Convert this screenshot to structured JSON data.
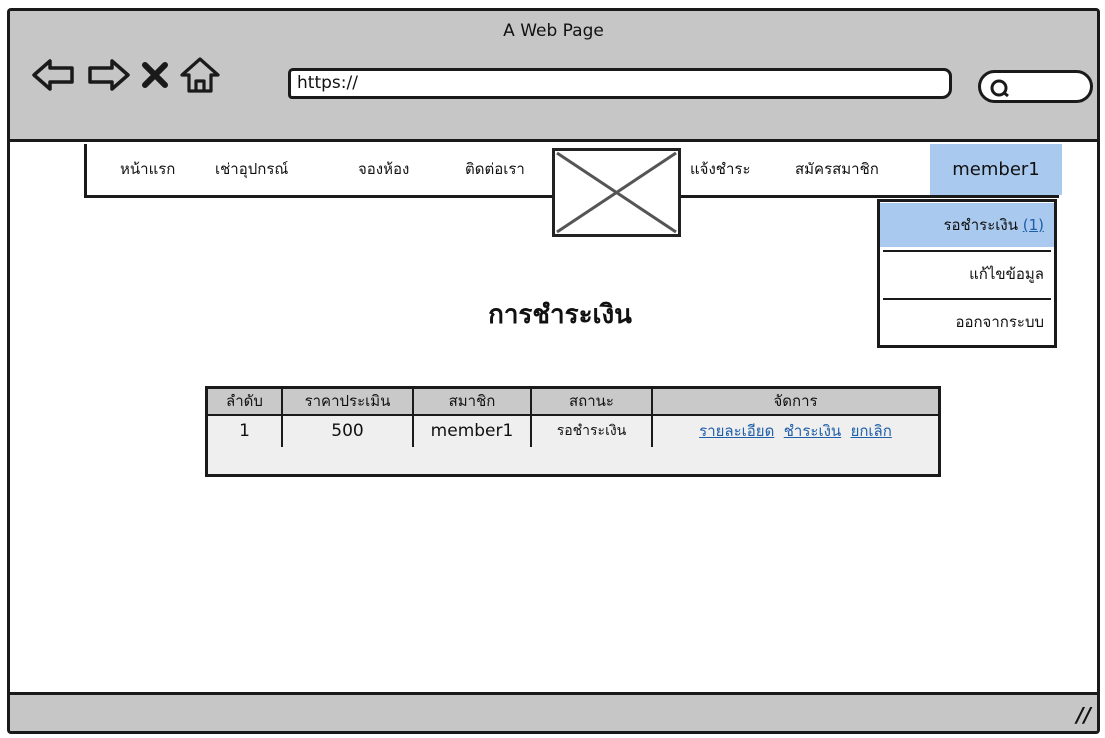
{
  "window": {
    "title": "A Web Page"
  },
  "browser": {
    "url": "https://"
  },
  "menu": {
    "items": [
      "หน้าแรก",
      "เช่าอุปกรณ์",
      "จองห้อง",
      "ติดต่อเรา",
      "แจ้งชำระ",
      "สมัครสมาชิก"
    ],
    "user": "member1"
  },
  "dropdown": {
    "pending_label": "รอชำระเงิน",
    "pending_count": "(1)",
    "edit_label": "แก้ไขข้อมูล",
    "logout_label": "ออกจากระบบ"
  },
  "page": {
    "title": "การชำระเงิน"
  },
  "table": {
    "headers": [
      "ลำดับ",
      "ราคาประเมิน",
      "สมาชิก",
      "สถานะ",
      "จัดการ"
    ],
    "rows": [
      {
        "no": "1",
        "price": "500",
        "member": "member1",
        "status": "รอชำระเงิน",
        "actions": [
          "รายละเอียด",
          "ชำระเงิน",
          "ยกเลิก"
        ]
      }
    ]
  },
  "colors": {
    "chrome": "#c6c6c6",
    "highlight": "#a9c9ef",
    "link": "#1f5fa8"
  },
  "icons": [
    "back-arrow-icon",
    "forward-arrow-icon",
    "close-icon",
    "home-icon",
    "search-icon",
    "resize-grip-icon"
  ]
}
